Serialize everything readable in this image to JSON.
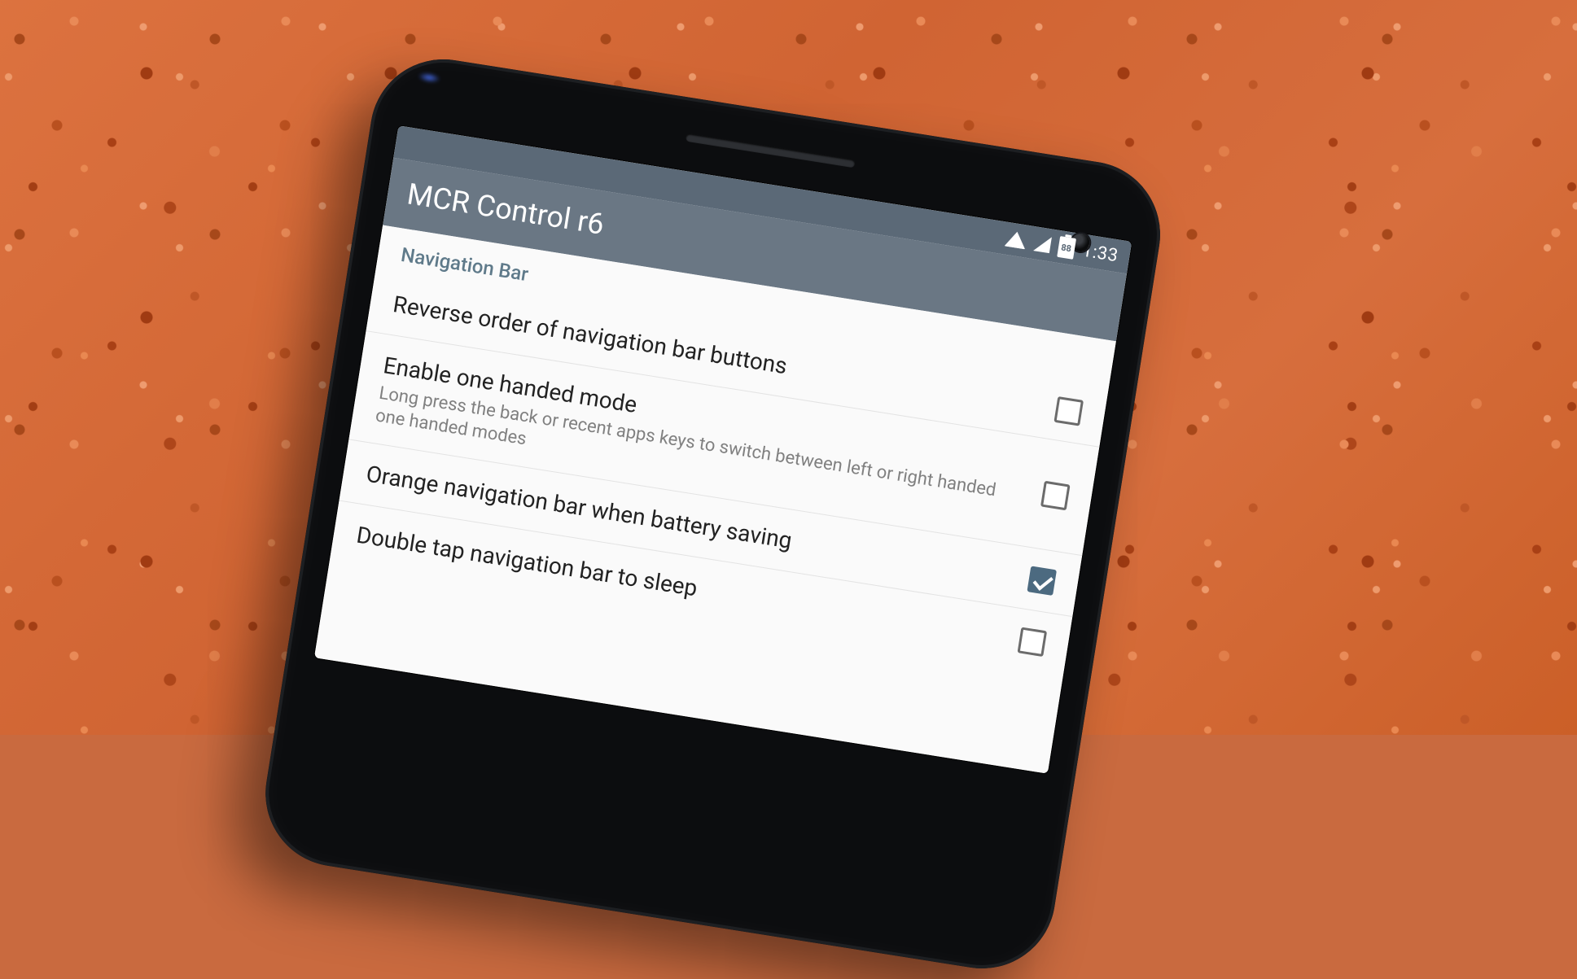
{
  "status": {
    "time": "1:33",
    "battery_pct": "88"
  },
  "appbar": {
    "title": "MCR Control r6"
  },
  "section": {
    "header": "Navigation Bar"
  },
  "rows": [
    {
      "title": "Reverse order of navigation bar buttons",
      "sub": "",
      "checked": false
    },
    {
      "title": "Enable one handed mode",
      "sub": "Long press the back or recent apps keys to switch between left or right handed one handed modes",
      "checked": false
    },
    {
      "title": "Orange navigation bar when battery saving",
      "sub": "",
      "checked": true
    },
    {
      "title": "Double tap navigation bar to sleep",
      "sub": "",
      "checked": false
    }
  ]
}
